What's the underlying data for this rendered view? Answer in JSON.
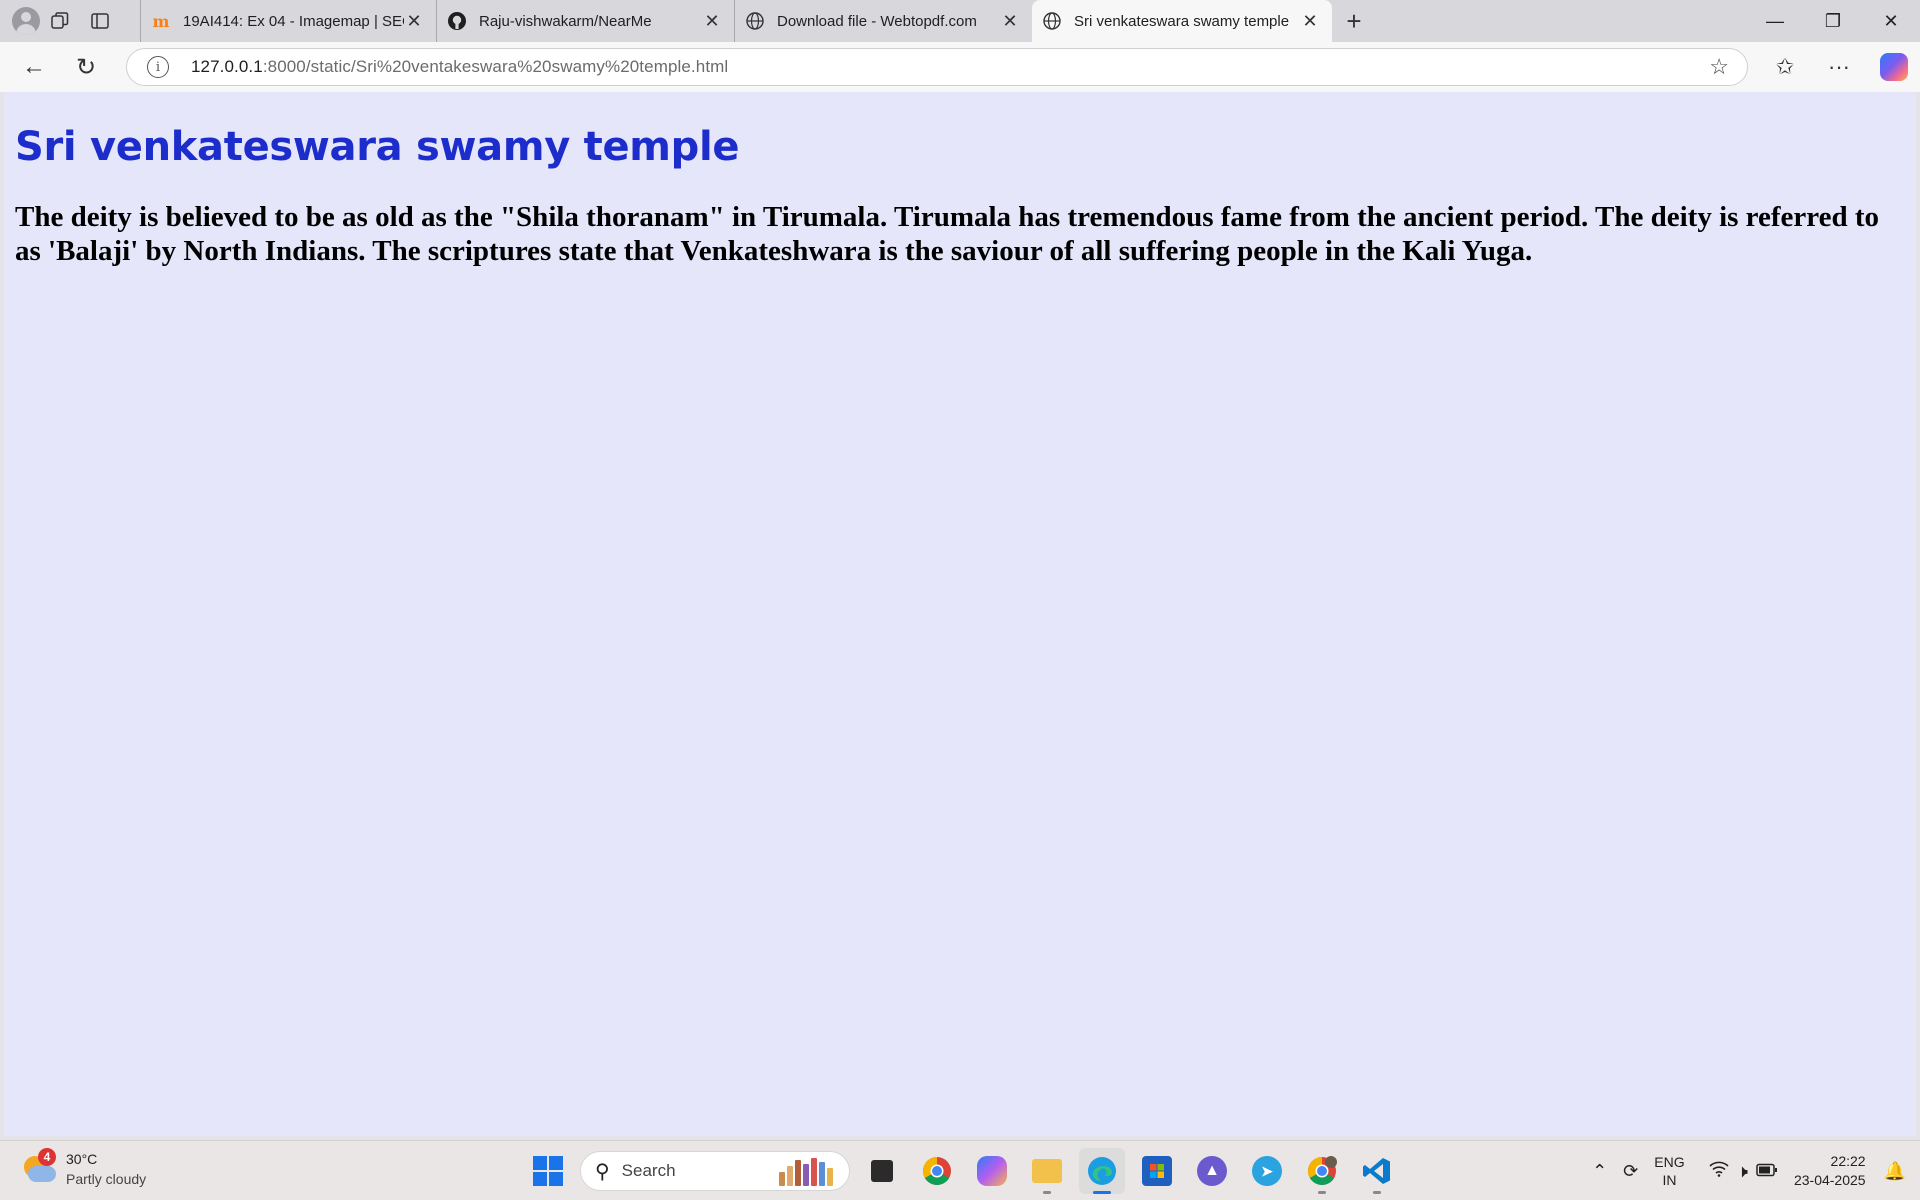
{
  "browser": {
    "tabs": [
      {
        "title": "19AI414: Ex 04 - Imagemap | SEC",
        "icon": "moodle-icon",
        "active": false
      },
      {
        "title": "Raju-vishwakarm/NearMe",
        "icon": "github-icon",
        "active": false
      },
      {
        "title": "Download file - Webtopdf.com",
        "icon": "globe-icon",
        "active": false
      },
      {
        "title": "Sri venkateswara swamy temple",
        "icon": "globe-icon",
        "active": true
      }
    ],
    "url_host": "127.0.0.1",
    "url_path": ":8000/static/Sri%20ventakeswara%20swamy%20temple.html"
  },
  "page": {
    "background": "#e6e6fa",
    "heading": "Sri venkateswara swamy temple",
    "heading_color": "#1c2dcc",
    "body_text": "The deity is believed to be as old as the \"Shila thoranam\" in Tirumala. Tirumala has tremendous fame from the ancient period. The deity is referred to as 'Balaji' by North Indians. The scriptures state that Venkateshwara is the saviour of all suffering people in the Kali Yuga."
  },
  "taskbar": {
    "weather": {
      "temp": "30°C",
      "condition": "Partly cloudy",
      "badge": "4"
    },
    "search_placeholder": "Search",
    "language": {
      "line1": "ENG",
      "line2": "IN"
    },
    "clock": {
      "time": "22:22",
      "date": "23-04-2025"
    }
  }
}
